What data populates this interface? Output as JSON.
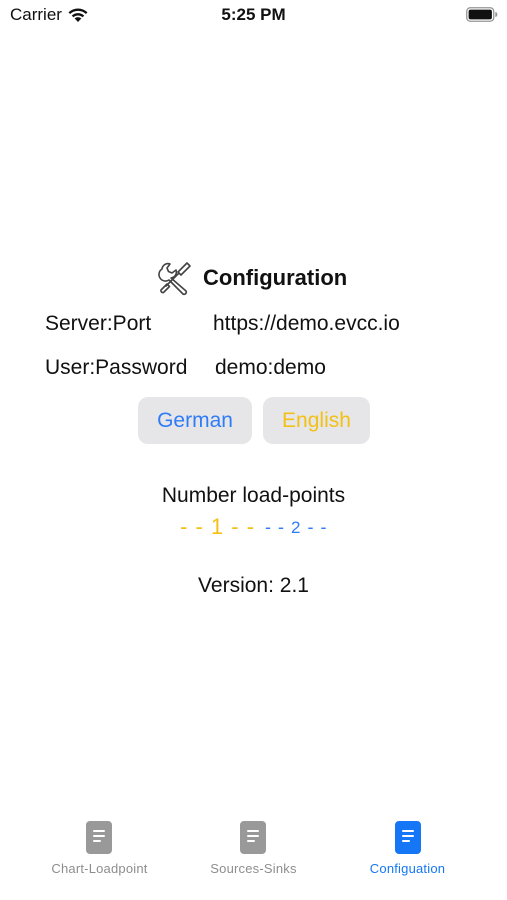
{
  "status_bar": {
    "carrier": "Carrier",
    "time": "5:25 PM",
    "wifi_icon": "wifi-icon",
    "battery_icon": "battery-icon"
  },
  "configuration": {
    "icon": "tools-icon",
    "title": "Configuration",
    "server_label": "Server:Port",
    "server_value": "https://demo.evcc.io",
    "user_label": "User:Password",
    "user_value": "demo:demo"
  },
  "language": {
    "german_label": "German",
    "english_label": "English",
    "german_color": "#2f7cf6",
    "english_color": "#f3c015"
  },
  "load_points": {
    "title": "Number load-points",
    "option_1": "1",
    "option_2": "2",
    "option_1_color": "#f3c015",
    "option_2_color": "#2f7cf6"
  },
  "version": "Version: 2.1",
  "tab_bar": {
    "tabs": [
      {
        "label": "Chart-Loadpoint",
        "icon": "document-icon",
        "active": false
      },
      {
        "label": "Sources-Sinks",
        "icon": "document-icon",
        "active": false
      },
      {
        "label": "Configuation",
        "icon": "document-icon",
        "active": true
      }
    ],
    "active_color": "#1577f5",
    "inactive_color": "#8e8e8e"
  }
}
